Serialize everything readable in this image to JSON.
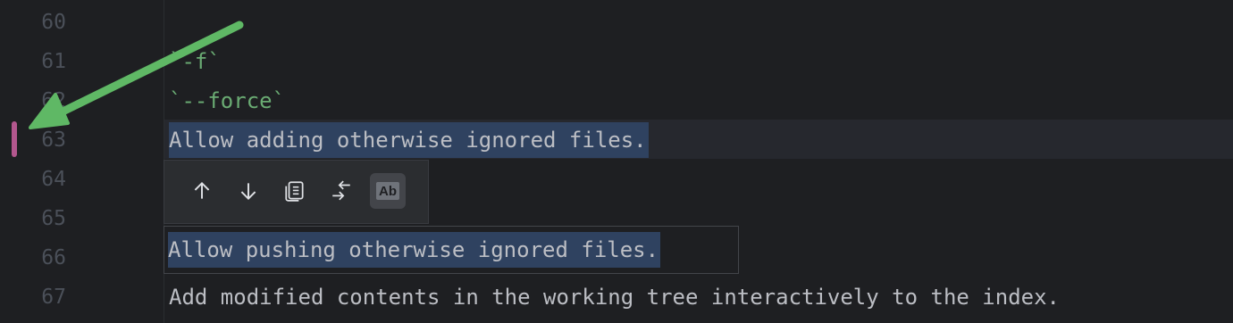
{
  "gutter": {
    "line_numbers": [
      "60",
      "61",
      "62",
      "63",
      "64",
      "65",
      "66",
      "67"
    ]
  },
  "editor": {
    "lines": {
      "l61": "`-f`",
      "l62": "`--force`",
      "l63": "Allow adding otherwise ignored files.",
      "l67": "Add modified contents in the working tree interactively to the index."
    }
  },
  "find_toolbar": {
    "icons": [
      "arrow-up-icon",
      "arrow-down-icon",
      "copy-occurrences-icon",
      "replace-icon",
      "match-case-icon"
    ],
    "match_case_label": "Ab"
  },
  "replace_field": {
    "value": "Allow pushing otherwise ignored files."
  },
  "colors": {
    "background": "#1e1f22",
    "selection": "#2f4260",
    "change_marker": "#b3578e",
    "annotation_arrow": "#5fb865"
  }
}
